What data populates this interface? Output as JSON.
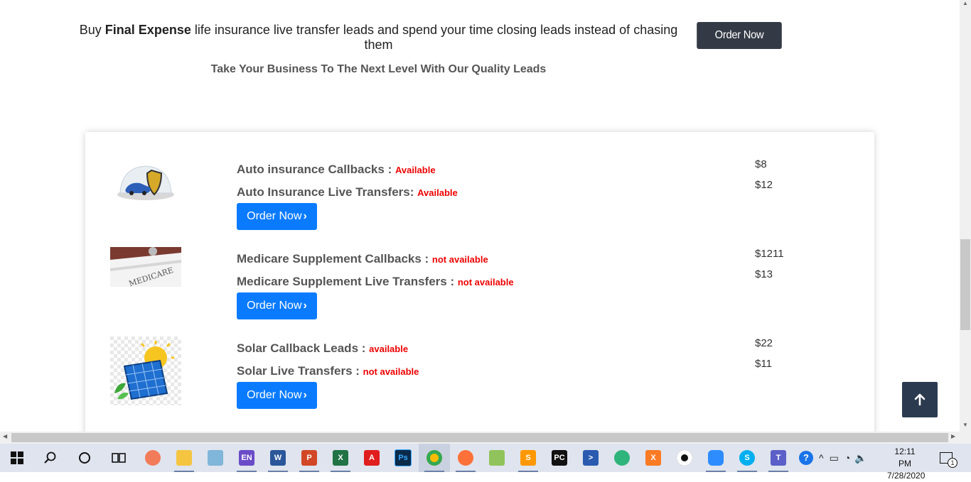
{
  "hero": {
    "prefix": "Buy ",
    "bold": "Final Expense",
    "rest": " life insurance live transfer leads and spend your time closing leads instead of chasing them",
    "subtitle": "Take Your Business To The Next Level With Our Quality Leads",
    "order_label": "Order Now"
  },
  "products": [
    {
      "image": "auto-insurance-shield-image",
      "line1_label": "Auto insurance Callbacks : ",
      "line1_status": "Available",
      "line2_label": "Auto Insurance Live Transfers: ",
      "line2_status": "Available",
      "price1": "$8",
      "price2": "$12",
      "order_label": "Order Now"
    },
    {
      "image": "medicare-card-image",
      "line1_label": "Medicare Supplement Callbacks : ",
      "line1_status": "not available",
      "line2_label": "Medicare Supplement Live Transfers : ",
      "line2_status": "not available",
      "price1": "$1211",
      "price2": "$13",
      "order_label": "Order Now"
    },
    {
      "image": "solar-panel-image",
      "line1_label": "Solar Callback Leads : ",
      "line1_status": "available",
      "line2_label": "Solar Live Transfers : ",
      "line2_status": "not available",
      "price1": "$22",
      "price2": "$11",
      "order_label": "Order Now"
    }
  ],
  "colors": {
    "order_button": "#0a7bff",
    "top_order_button": "#343a45",
    "status_text": "#e00000",
    "back_to_top": "#2b3a4e"
  },
  "taskbar": {
    "apps": [
      "windows-start-icon",
      "search-icon",
      "cortana-icon",
      "task-view-icon",
      "paint-icon",
      "file-explorer-icon",
      "notepad-icon",
      "en-app-icon",
      "word-icon",
      "powerpoint-icon",
      "excel-icon",
      "acrobat-icon",
      "photoshop-icon",
      "chrome-icon",
      "firefox-icon",
      "notepad-plus-icon",
      "sublime-icon",
      "pycharm-icon",
      "powershell-icon",
      "atom-icon",
      "xampp-icon",
      "recorder-icon",
      "zoom-icon",
      "skype-icon",
      "teams-icon"
    ],
    "time": "12:11 PM",
    "date": "7/28/2020",
    "notification_count": "1"
  }
}
